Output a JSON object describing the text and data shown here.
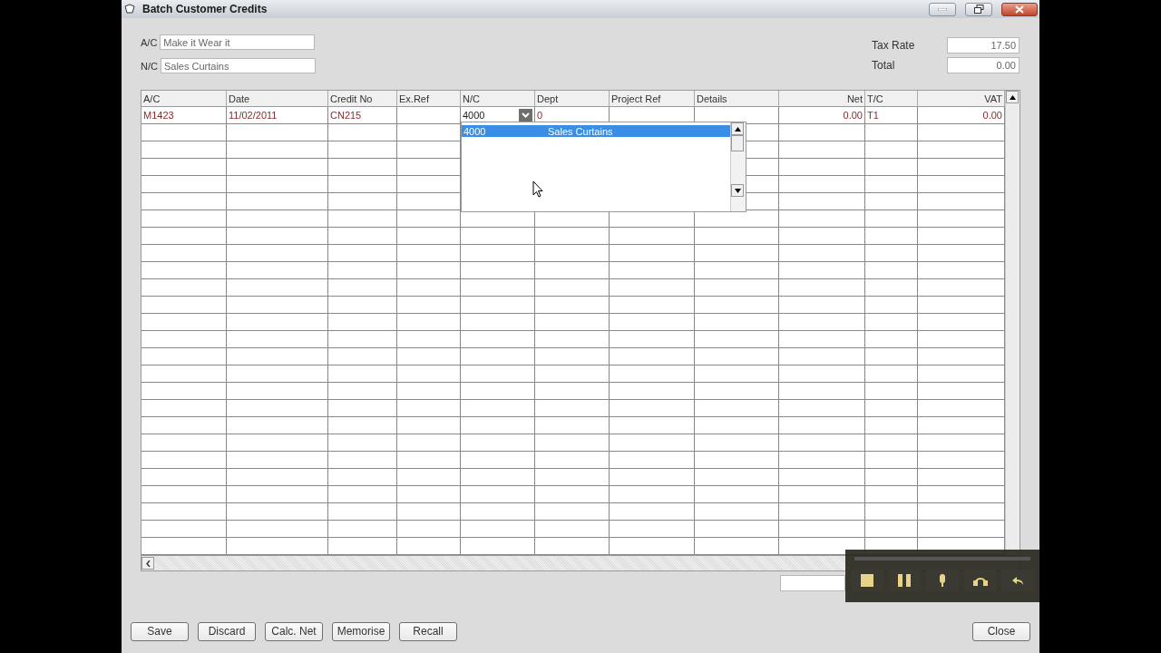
{
  "window": {
    "title": "Batch Customer Credits"
  },
  "header": {
    "account": {
      "label": "A/C",
      "value": "Make it Wear it"
    },
    "nominal": {
      "label": "N/C",
      "value": "Sales Curtains"
    },
    "tax_rate": {
      "label": "Tax Rate",
      "value": "17.50"
    },
    "total": {
      "label": "Total",
      "value": "0.00"
    }
  },
  "table": {
    "columns": [
      "A/C",
      "Date",
      "Credit No",
      "Ex.Ref",
      "N/C",
      "Dept",
      "Project Ref",
      "Details",
      "Net",
      "T/C",
      "VAT"
    ],
    "rows": [
      {
        "cells": [
          {
            "text": "M1423",
            "kind": "text"
          },
          {
            "text": "11/02/2011",
            "kind": "text"
          },
          {
            "text": "CN215",
            "kind": "text"
          },
          null,
          {
            "text": "4000",
            "kind": "combo"
          },
          {
            "text": "0",
            "kind": "text"
          },
          null,
          null,
          {
            "text": "0.00",
            "kind": "text"
          },
          {
            "text": "T1",
            "kind": "text"
          },
          {
            "text": "0.00",
            "kind": "text"
          }
        ]
      }
    ]
  },
  "nc_dropdown": {
    "items": [
      {
        "code": "4000",
        "name": "Sales Curtains",
        "selected": true
      }
    ]
  },
  "buttons": [
    "Save",
    "Discard",
    "Calc. Net",
    "Memorise",
    "Recall"
  ],
  "close_button": "Close"
}
